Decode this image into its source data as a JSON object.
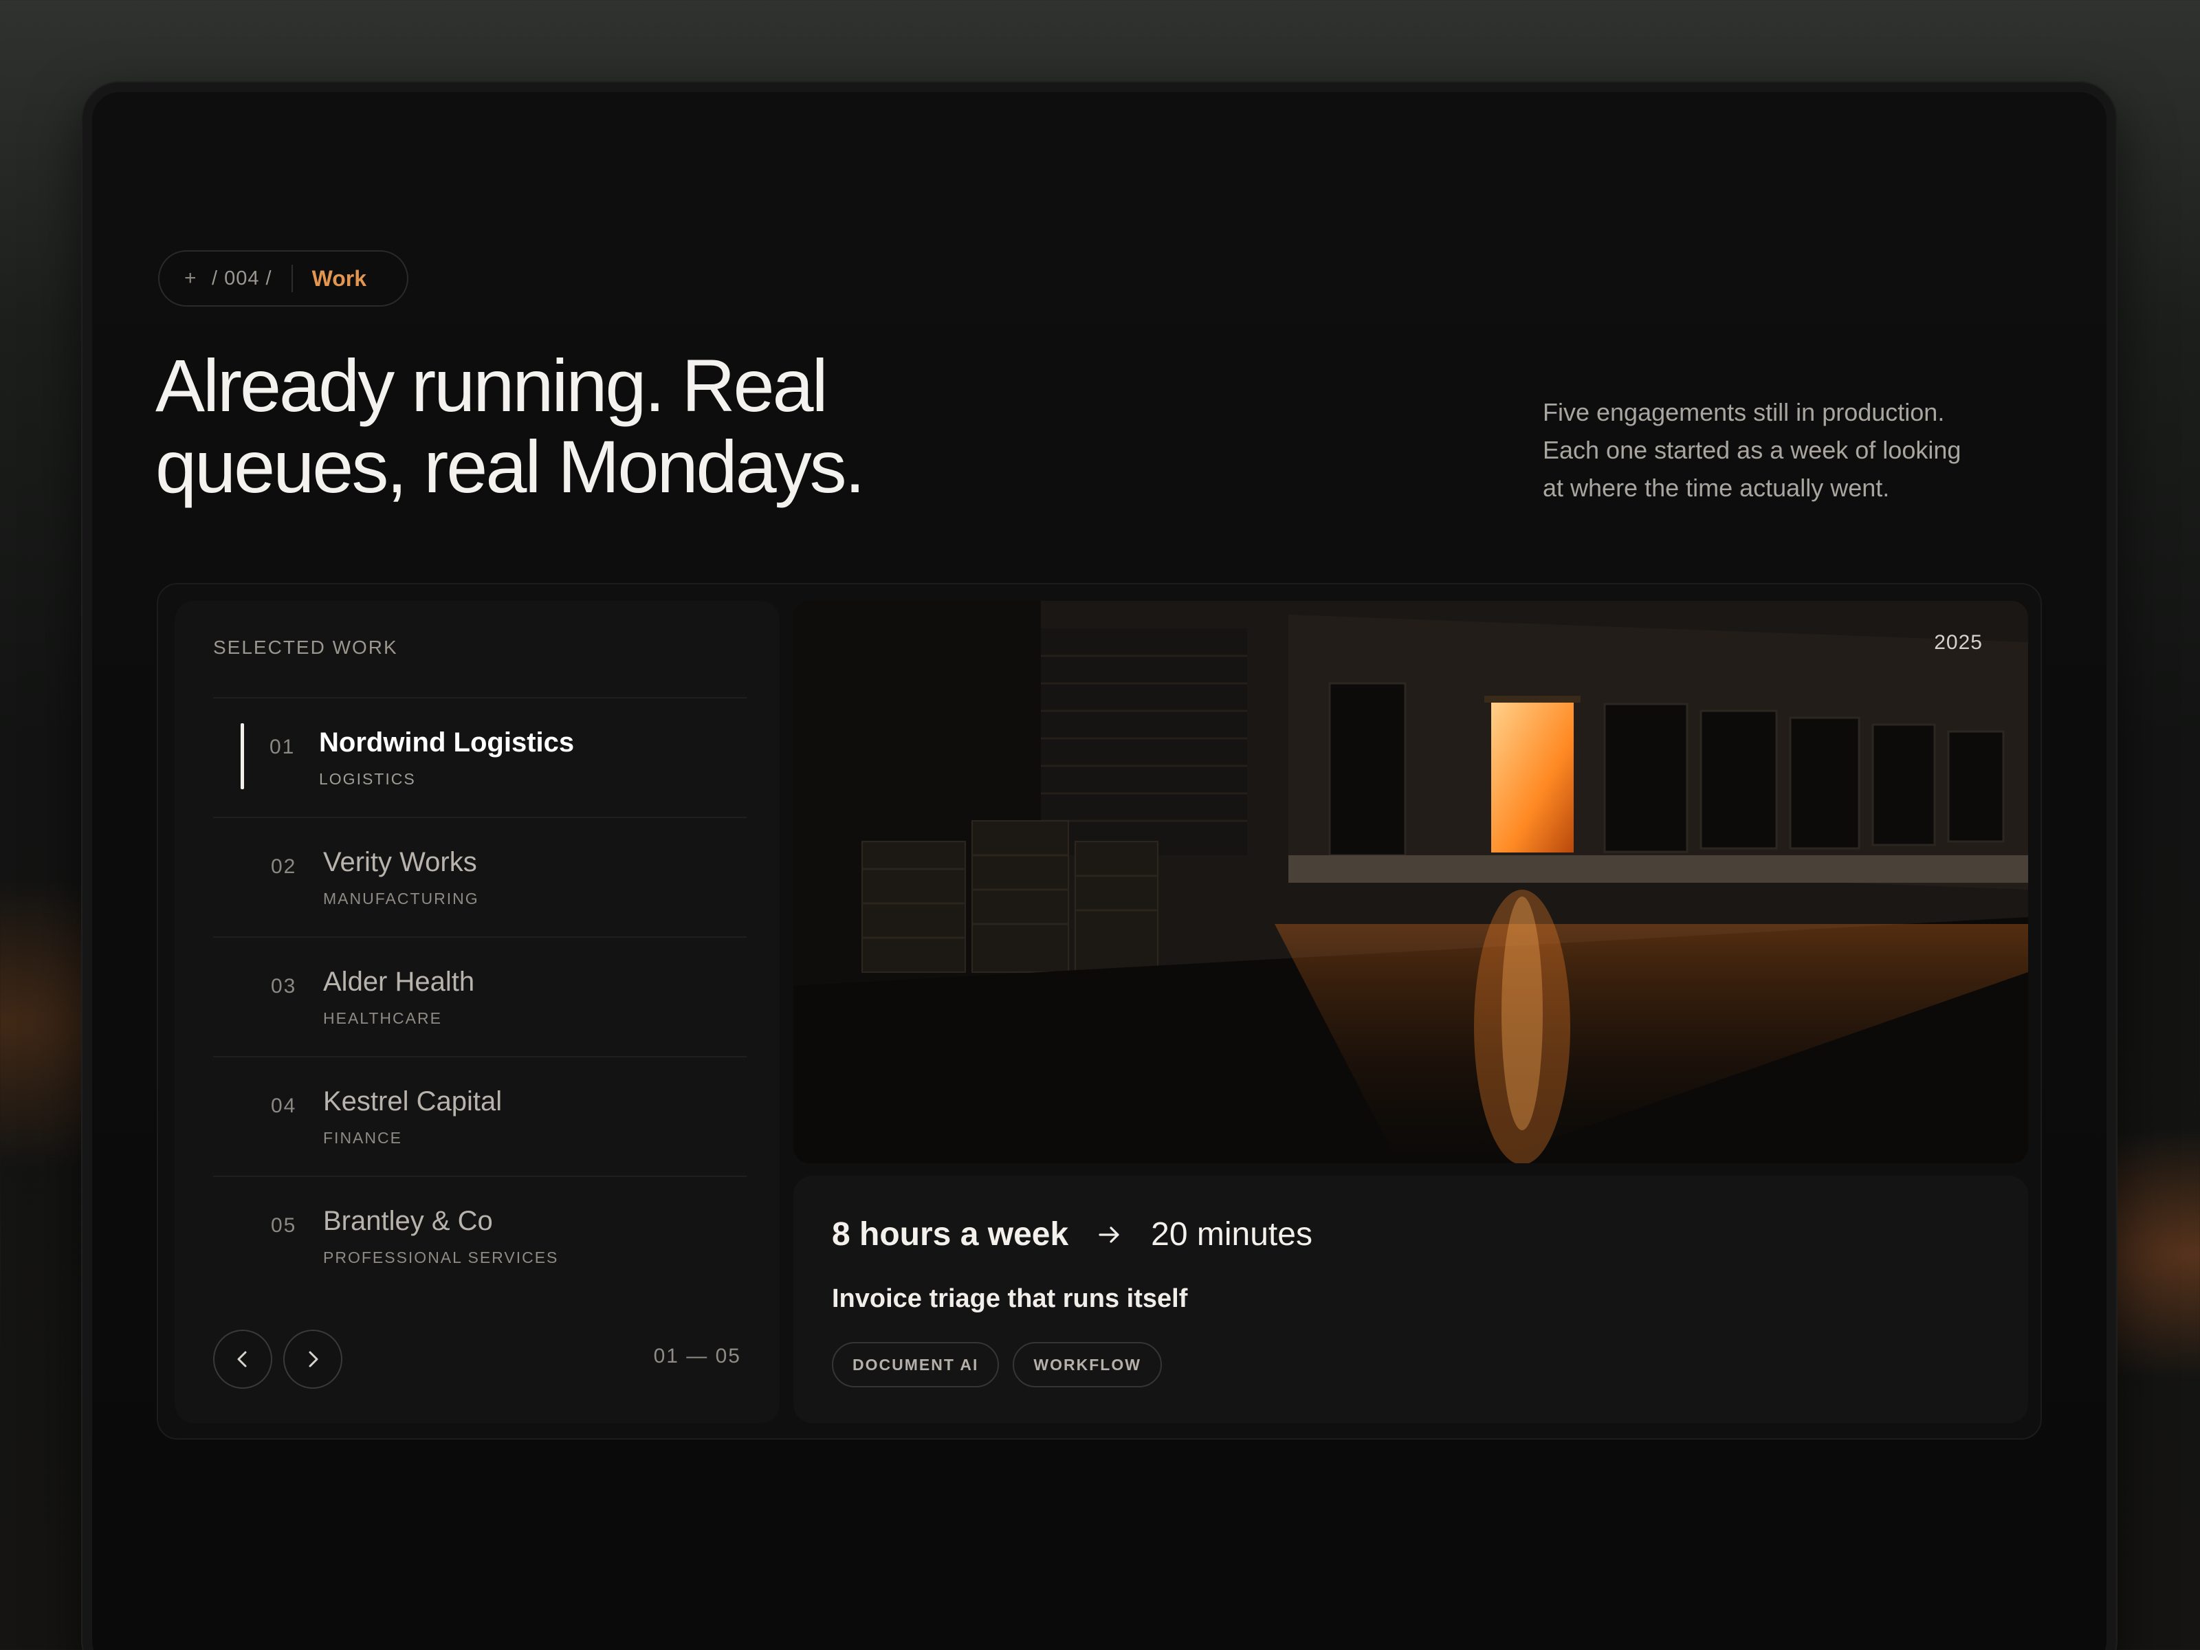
{
  "breadcrumb": {
    "plus": "+",
    "path": "/ 004 /",
    "current": "Work"
  },
  "headline": {
    "line1": "Already running. Real",
    "line2": "queues, real Mondays."
  },
  "intro": {
    "line1": "Five engagements still in production.",
    "line2": "Each one started as a week of looking",
    "line3": "at where the time actually went."
  },
  "selected_work": {
    "title": "SELECTED WORK",
    "items": [
      {
        "num": "01",
        "name": "Nordwind Logistics",
        "sector": "LOGISTICS"
      },
      {
        "num": "02",
        "name": "Verity Works",
        "sector": "MANUFACTURING"
      },
      {
        "num": "03",
        "name": "Alder Health",
        "sector": "HEALTHCARE"
      },
      {
        "num": "04",
        "name": "Kestrel Capital",
        "sector": "FINANCE"
      },
      {
        "num": "05",
        "name": "Brantley & Co",
        "sector": "PROFESSIONAL SERVICES"
      }
    ],
    "counter": "01 — 05"
  },
  "feature": {
    "year": "2025",
    "metric_from": "8 hours a week",
    "metric_to": "20 minutes",
    "title": "Invoice triage that runs itself",
    "tags": [
      "DOCUMENT AI",
      "WORKFLOW"
    ]
  },
  "colors": {
    "accent": "#e29650",
    "background": "#0c0c0c"
  }
}
